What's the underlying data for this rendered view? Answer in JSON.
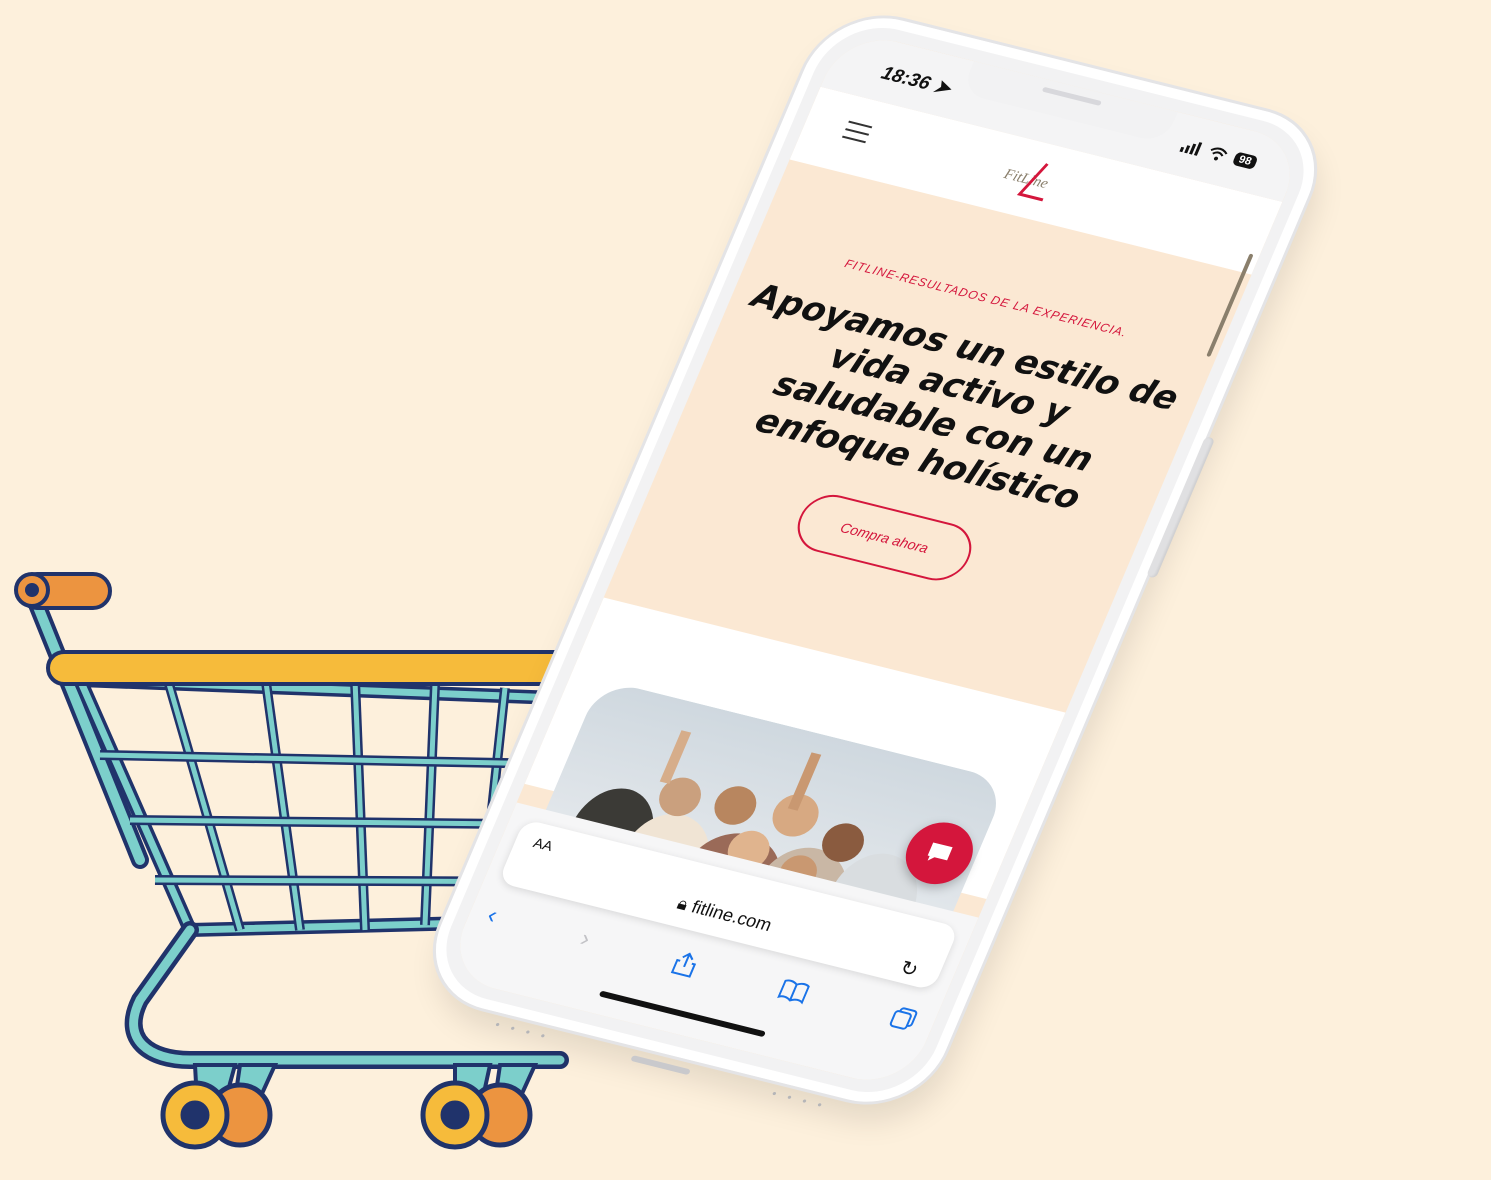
{
  "status_bar": {
    "time": "18:36",
    "battery": "98"
  },
  "site": {
    "logo_text": "FitLine",
    "eyebrow": "FITLINE-RESULTADOS DE LA EXPERIENCIA.",
    "headline": "Apoyamos un estilo de vida activo y saludable con un enfoque holístico",
    "cta_label": "Compra ahora"
  },
  "browser": {
    "text_size_label": "AA",
    "url": "fitline.com"
  },
  "colors": {
    "brand_red": "#d4163c",
    "hero_bg": "#fbe8d3",
    "page_bg": "#fdf0dc"
  },
  "icons": {
    "back": "chevron-left-icon",
    "forward": "chevron-right-icon",
    "share": "share-icon",
    "bookmarks": "book-icon",
    "tabs": "tabs-icon",
    "reload": "reload-icon",
    "lock": "lock-icon",
    "chat": "chat-bubble-icon"
  }
}
